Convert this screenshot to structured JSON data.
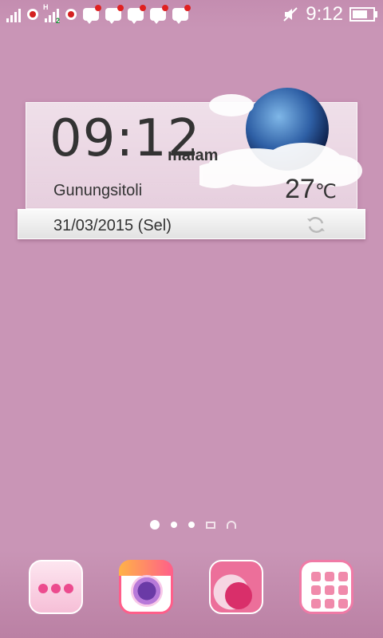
{
  "status_bar": {
    "signal_1_network": "",
    "signal_2_network": "H",
    "signal_2_sim": "2",
    "notifications": [
      "flag-icon",
      "flag-icon",
      "bbm-icon",
      "bbm-icon",
      "bbm-icon",
      "bbm-icon",
      "bbm-icon"
    ],
    "mute_icon": "vibrate-off-icon",
    "time": "9:12",
    "battery_icon": "battery-full-icon"
  },
  "widget": {
    "clock": "09:12",
    "period": "malam",
    "city": "Gunungsitoli",
    "temperature": "27",
    "temperature_unit": "℃",
    "date": "31/03/2015 (Sel)"
  },
  "home_pages": {
    "indicators": [
      "home",
      "page",
      "page",
      "widgets",
      "apps"
    ],
    "active_index": 0
  },
  "dock": {
    "apps": [
      "messaging-app-icon",
      "camera-app-icon",
      "phone-app-icon",
      "app-drawer-icon"
    ]
  },
  "colors": {
    "background": "#c995b6",
    "accent": "#ec4b8e"
  }
}
